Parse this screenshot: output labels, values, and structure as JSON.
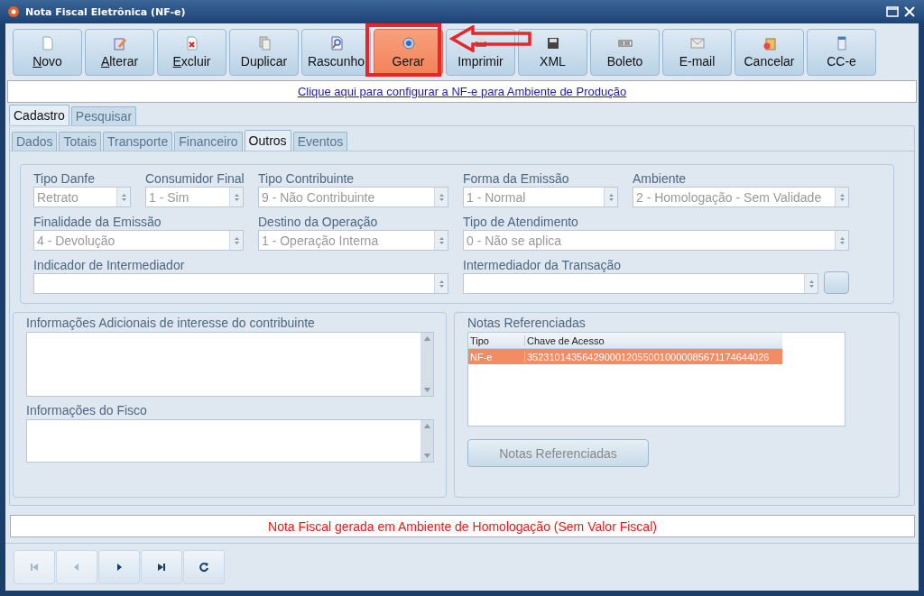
{
  "window": {
    "title": "Nota Fiscal Eletrônica (NF-e)"
  },
  "toolbar": [
    {
      "label": "Novo",
      "mnemonic": true,
      "selected": false
    },
    {
      "label": "Alterar",
      "mnemonic": true,
      "selected": false
    },
    {
      "label": "Excluir",
      "mnemonic": true,
      "selected": false
    },
    {
      "label": "Duplicar",
      "mnemonic": false,
      "selected": false
    },
    {
      "label": "Rascunho",
      "mnemonic": false,
      "selected": false
    },
    {
      "label": "Gerar",
      "mnemonic": false,
      "selected": true
    },
    {
      "label": "Imprimir",
      "mnemonic": false,
      "selected": false
    },
    {
      "label": "XML",
      "mnemonic": false,
      "selected": false
    },
    {
      "label": "Boleto",
      "mnemonic": false,
      "selected": false
    },
    {
      "label": "E-mail",
      "mnemonic": false,
      "selected": false
    },
    {
      "label": "Cancelar",
      "mnemonic": false,
      "selected": false
    },
    {
      "label": "CC-e",
      "mnemonic": false,
      "selected": false
    }
  ],
  "config_link": "Clique aqui para configurar a NF-e para Ambiente de Produção",
  "tabs": [
    {
      "label": "Cadastro",
      "selected": true
    },
    {
      "label": "Pesquisar",
      "selected": false
    }
  ],
  "subtabs": [
    {
      "label": "Dados",
      "selected": false
    },
    {
      "label": "Totais",
      "selected": false
    },
    {
      "label": "Transporte",
      "selected": false
    },
    {
      "label": "Financeiro",
      "selected": false
    },
    {
      "label": "Outros",
      "selected": true
    },
    {
      "label": "Eventos",
      "selected": false
    }
  ],
  "fields": [
    {
      "label": "Tipo Danfe",
      "value": "Retrato"
    },
    {
      "label": "Consumidor Final",
      "value": "1 - Sim"
    },
    {
      "label": "Tipo Contribuinte",
      "value": "9 - Não Contribuinte"
    },
    {
      "label": "Forma da Emissão",
      "value": "1 - Normal"
    },
    {
      "label": "Ambiente",
      "value": "2 - Homologação - Sem Validade"
    },
    {
      "label": "Finalidade da Emissão",
      "value": "4 - Devolução"
    },
    {
      "label": "Destino da Operação",
      "value": "1 - Operação Interna"
    },
    {
      "label": "Tipo de Atendimento",
      "value": "0 - Não se aplica"
    },
    {
      "label": "Indicador de Intermediador"
    },
    {
      "label": "Intermediador da Transação"
    }
  ],
  "additional_info": {
    "label": "Informações Adicionais de interesse do contribuinte"
  },
  "fisco_info": {
    "label": "Informações do Fisco"
  },
  "referenced_notes": {
    "title": "Notas Referenciadas",
    "columns": [
      "Tipo",
      "Chave de Acesso"
    ],
    "rows": [
      {
        "cells": [
          "NF-e",
          "35231014356429000120550010000085671174644026"
        ],
        "selected": true
      }
    ],
    "button": "Notas Referenciadas"
  },
  "status": "Nota Fiscal gerada em Ambiente de Homologação (Sem Valor Fiscal)",
  "navigation": [
    {
      "disabled": true
    },
    {
      "disabled": true
    },
    {
      "disabled": false
    },
    {
      "disabled": false
    },
    {
      "disabled": false
    }
  ]
}
